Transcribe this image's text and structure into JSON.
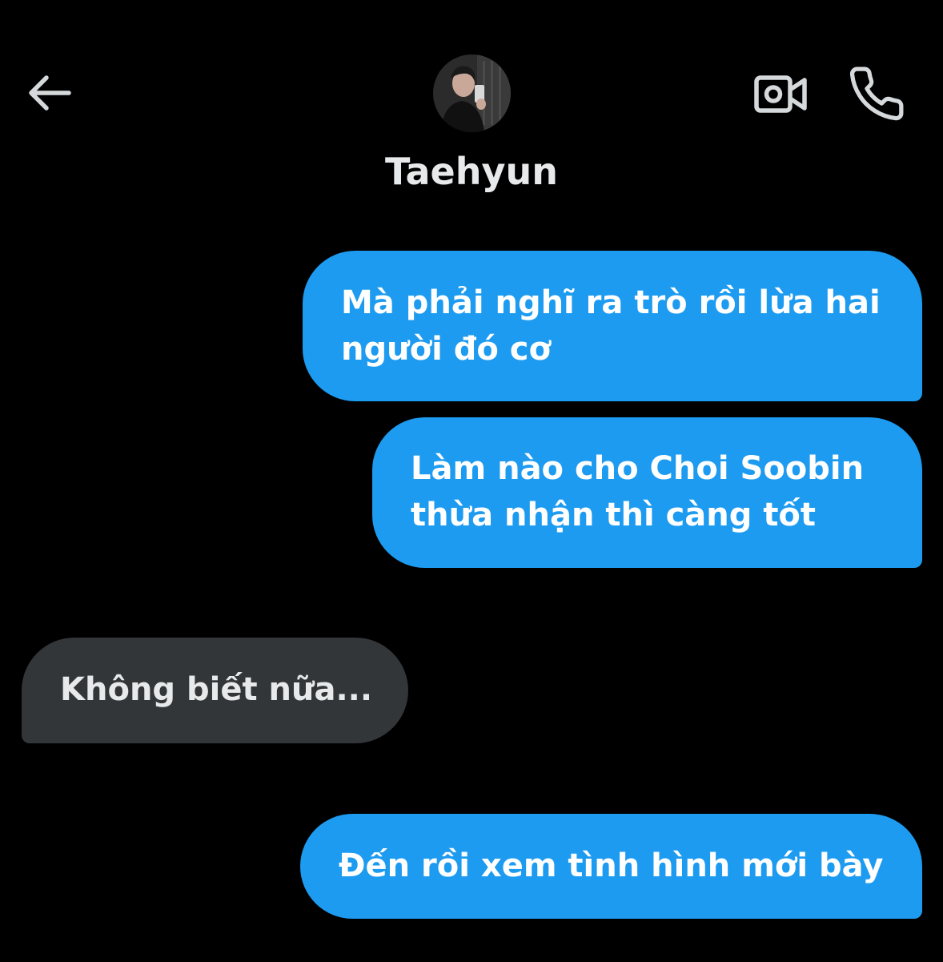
{
  "header": {
    "back_icon": "arrow-left-icon",
    "contact_name": "Taehyun",
    "avatar_icon": "profile-photo",
    "video_icon": "video-camera-icon",
    "call_icon": "phone-icon"
  },
  "messages": [
    {
      "direction": "sent",
      "text": "Mà phải nghĩ ra trò rồi lừa hai\nngười đó cơ"
    },
    {
      "direction": "sent",
      "text": "Làm nào cho Choi Soobin\nthừa nhận thì càng tốt"
    },
    {
      "direction": "received",
      "text": "Không biết nữa..."
    },
    {
      "direction": "sent",
      "text": "Đến rồi xem tình hình mới bày"
    }
  ],
  "colors": {
    "background": "#000000",
    "sent_bubble": "#1d9bf0",
    "received_bubble": "#333639",
    "text": "#ffffff",
    "icon": "#d6d9db"
  }
}
